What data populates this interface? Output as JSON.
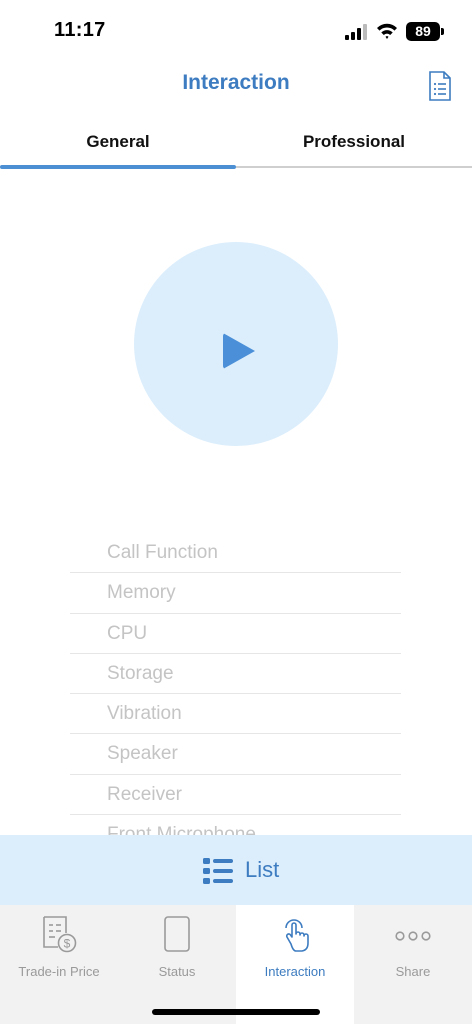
{
  "status_bar": {
    "time": "11:17",
    "battery": "89"
  },
  "nav": {
    "title": "Interaction"
  },
  "tabs": [
    {
      "label": "General",
      "active": true
    },
    {
      "label": "Professional",
      "active": false
    }
  ],
  "test_items": [
    "Call Function",
    "Memory",
    "CPU",
    "Storage",
    "Vibration",
    "Speaker",
    "Receiver",
    "Front Microphone"
  ],
  "list_bar": {
    "label": "List"
  },
  "bottom_tabs": [
    {
      "label": "Trade-in Price",
      "icon": "receipt-dollar-icon",
      "active": false
    },
    {
      "label": "Status",
      "icon": "phone-icon",
      "active": false
    },
    {
      "label": "Interaction",
      "icon": "tap-hand-icon",
      "active": true
    },
    {
      "label": "Share",
      "icon": "more-dots-icon",
      "active": false
    }
  ],
  "colors": {
    "accent": "#3d7cc0",
    "play_bg": "#dceefc",
    "tab_bar_bg": "#f2f2f2"
  }
}
